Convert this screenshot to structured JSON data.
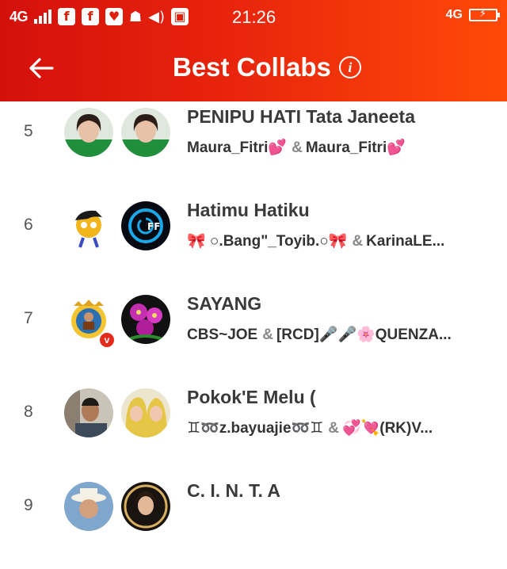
{
  "status_bar": {
    "network": "4G",
    "app_icons": [
      "f",
      "f"
    ],
    "time": "21:26",
    "network_right": "4G"
  },
  "header": {
    "title": "Best Collabs"
  },
  "rows": [
    {
      "rank": "5",
      "song": "PENIPU HATI Tata Janeeta",
      "artist1": "Maura_Fitri💕",
      "artist2": "Maura_Fitri💕"
    },
    {
      "rank": "6",
      "song": "Hatimu Hatiku",
      "artist1": "🎀 ○.Bang\"_Toyib.○🎀",
      "artist2": "KarinaLE..."
    },
    {
      "rank": "7",
      "song": "SAYANG",
      "artist1": "CBS~JOE",
      "artist2": "[RCD]🎤🎤🌸QUENZA..."
    },
    {
      "rank": "8",
      "song": "Pokok'E Melu (",
      "artist1": "♊➿z.bayuajie➿♊",
      "artist2": "💞💘(RK)V..."
    },
    {
      "rank": "9",
      "song": "C. I. N. T. A",
      "artist1": "",
      "artist2": ""
    }
  ],
  "amp": "&",
  "colors": {
    "header_start": "#d4100c",
    "header_end": "#ff4a08",
    "verified_badge": "#e42a1a"
  },
  "icons": {
    "back": "back-arrow-icon",
    "info": "info-icon",
    "verified": "verified-badge-icon"
  }
}
